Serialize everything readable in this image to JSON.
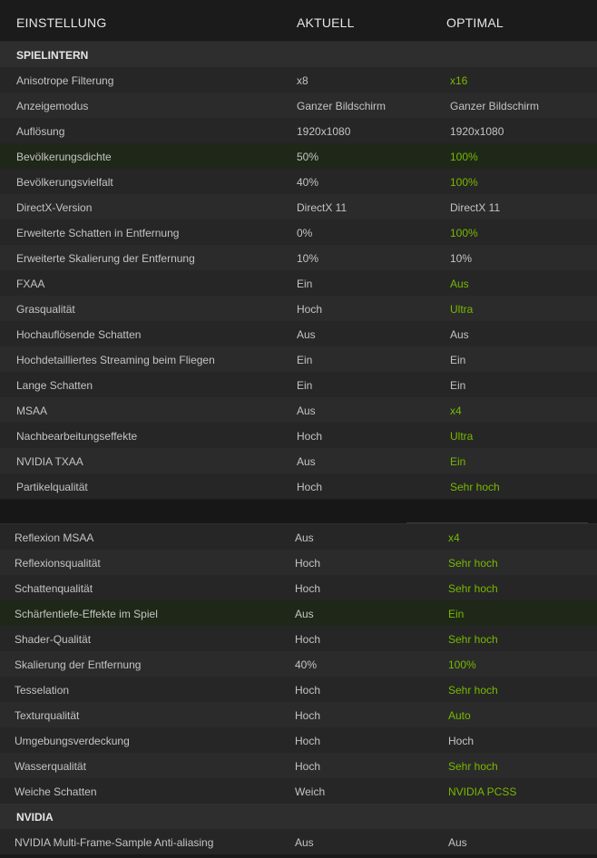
{
  "header": {
    "col1": "EINSTELLUNG",
    "col2": "AKTUELL",
    "col3": "OPTIMAL"
  },
  "colors": {
    "green": "#76b900",
    "highlight": "#1f2818"
  },
  "panel1": [
    {
      "type": "section",
      "label": "SPIELINTERN"
    },
    {
      "name": "Anisotrope Filterung",
      "cur": "x8",
      "opt": "x16",
      "green": true
    },
    {
      "name": "Anzeigemodus",
      "cur": "Ganzer Bildschirm",
      "opt": "Ganzer Bildschirm",
      "green": false
    },
    {
      "name": "Auflösung",
      "cur": "1920x1080",
      "opt": "1920x1080",
      "green": false
    },
    {
      "name": "Bevölkerungsdichte",
      "cur": "50%",
      "opt": "100%",
      "green": true,
      "highlight": true
    },
    {
      "name": "Bevölkerungsvielfalt",
      "cur": "40%",
      "opt": "100%",
      "green": true
    },
    {
      "name": "DirectX-Version",
      "cur": "DirectX 11",
      "opt": "DirectX 11",
      "green": false
    },
    {
      "name": "Erweiterte Schatten in Entfernung",
      "cur": "0%",
      "opt": "100%",
      "green": true
    },
    {
      "name": "Erweiterte Skalierung der Entfernung",
      "cur": "10%",
      "opt": "10%",
      "green": false
    },
    {
      "name": "FXAA",
      "cur": "Ein",
      "opt": "Aus",
      "green": true
    },
    {
      "name": "Grasqualität",
      "cur": "Hoch",
      "opt": "Ultra",
      "green": true
    },
    {
      "name": "Hochauflösende Schatten",
      "cur": "Aus",
      "opt": "Aus",
      "green": false
    },
    {
      "name": "Hochdetailliertes Streaming beim Fliegen",
      "cur": "Ein",
      "opt": "Ein",
      "green": false
    },
    {
      "name": "Lange Schatten",
      "cur": "Ein",
      "opt": "Ein",
      "green": false
    },
    {
      "name": "MSAA",
      "cur": "Aus",
      "opt": "x4",
      "green": true
    },
    {
      "name": "Nachbearbeitungseffekte",
      "cur": "Hoch",
      "opt": "Ultra",
      "green": true
    },
    {
      "name": "NVIDIA TXAA",
      "cur": "Aus",
      "opt": "Ein",
      "green": true
    },
    {
      "name": "Partikelqualität",
      "cur": "Hoch",
      "opt": "Sehr hoch",
      "green": true
    }
  ],
  "panel2": [
    {
      "name": "Reflexion MSAA",
      "cur": "Aus",
      "opt": "x4",
      "green": true
    },
    {
      "name": "Reflexionsqualität",
      "cur": "Hoch",
      "opt": "Sehr hoch",
      "green": true
    },
    {
      "name": "Schattenqualität",
      "cur": "Hoch",
      "opt": "Sehr hoch",
      "green": true
    },
    {
      "name": "Schärfentiefe-Effekte im Spiel",
      "cur": "Aus",
      "opt": "Ein",
      "green": true,
      "highlight": true
    },
    {
      "name": "Shader-Qualität",
      "cur": "Hoch",
      "opt": "Sehr hoch",
      "green": true
    },
    {
      "name": "Skalierung der Entfernung",
      "cur": "40%",
      "opt": "100%",
      "green": true
    },
    {
      "name": "Tesselation",
      "cur": "Hoch",
      "opt": "Sehr hoch",
      "green": true
    },
    {
      "name": "Texturqualität",
      "cur": "Hoch",
      "opt": "Auto",
      "green": true
    },
    {
      "name": "Umgebungsverdeckung",
      "cur": "Hoch",
      "opt": "Hoch",
      "green": false
    },
    {
      "name": "Wasserqualität",
      "cur": "Hoch",
      "opt": "Sehr hoch",
      "green": true
    },
    {
      "name": "Weiche Schatten",
      "cur": "Weich",
      "opt": "NVIDIA PCSS",
      "green": true
    },
    {
      "type": "section",
      "label": "NVIDIA"
    },
    {
      "name": "NVIDIA Multi-Frame-Sample Anti-aliasing",
      "cur": "Aus",
      "opt": "Aus",
      "green": false
    }
  ]
}
